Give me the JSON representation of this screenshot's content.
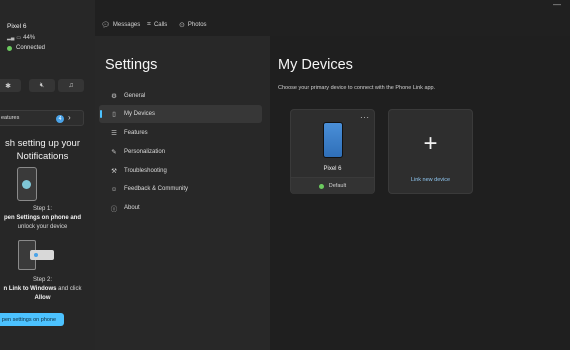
{
  "phone_panel": {
    "app_mark": "a",
    "device_name": "Pixel 6",
    "battery": "44%",
    "connection": "Connected",
    "features_label": "eatures",
    "features_count": "4",
    "finish_title_line1": "sh setting up your",
    "finish_title_line2": "Notifications",
    "step1_label": "Step 1:",
    "step1_line1": "pen Settings on phone and",
    "step1_line2": "unlock your device",
    "step2_label": "Step 2:",
    "step2_bold": "n Link to Windows",
    "step2_rest": " and click",
    "step2_allow": "Allow",
    "open_button": "pen settings on phone"
  },
  "topnav": {
    "tabs": [
      {
        "label": "Messages",
        "icon": "message-icon"
      },
      {
        "label": "Calls",
        "icon": "calls-icon"
      },
      {
        "label": "Photos",
        "icon": "photos-icon"
      }
    ]
  },
  "settings": {
    "title": "Settings",
    "items": [
      {
        "label": "General",
        "icon": "gear-icon"
      },
      {
        "label": "My Devices",
        "icon": "phone-icon"
      },
      {
        "label": "Features",
        "icon": "features-icon"
      },
      {
        "label": "Personalization",
        "icon": "brush-icon"
      },
      {
        "label": "Troubleshooting",
        "icon": "wrench-icon"
      },
      {
        "label": "Feedback & Community",
        "icon": "feedback-icon"
      },
      {
        "label": "About",
        "icon": "info-icon"
      }
    ],
    "active": "My Devices"
  },
  "main": {
    "title": "My Devices",
    "subtitle": "Choose your primary device to connect with the Phone Link app.",
    "device_card": {
      "name": "Pixel 6",
      "status": "Default"
    },
    "add_card": {
      "label": "Link new device"
    }
  },
  "colors": {
    "accent": "#4cc2ff",
    "connected": "#6ccb5f",
    "phone_screen": "#3d7fcc"
  }
}
